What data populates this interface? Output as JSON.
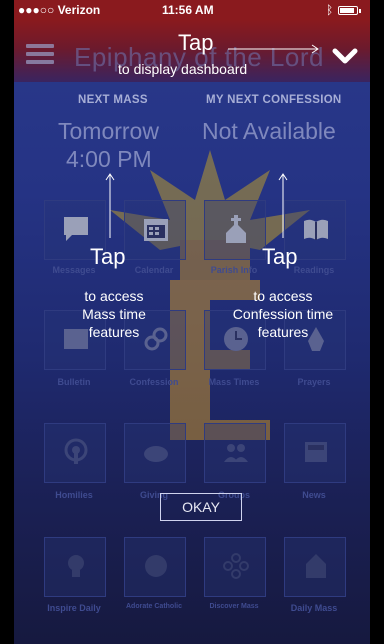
{
  "status_bar": {
    "carrier": "●●●○○ Verizon",
    "time": "11:56 AM"
  },
  "header": {
    "title": "Epiphany of the Lord"
  },
  "next_mass": {
    "label": "NEXT MASS",
    "line1": "Tomorrow",
    "line2": "4:00 PM"
  },
  "next_confession": {
    "label": "MY NEXT CONFESSION",
    "value": "Not Available"
  },
  "grid": {
    "row1": [
      "Messages",
      "Calendar",
      "Parish Info",
      "Readings"
    ],
    "row2": [
      "Bulletin",
      "Confession",
      "Mass Times",
      "Prayers"
    ],
    "row3": [
      "Homilies",
      "Giving",
      "Groups",
      "News"
    ],
    "row4": [
      "Inspire Daily",
      "Adorate Catholic",
      "Discover Mass",
      "Daily Mass"
    ]
  },
  "tutorial": {
    "top_tap": "Tap",
    "top_desc": "to display dashboard",
    "left_tap": "Tap",
    "left_desc": [
      "to access",
      "Mass time",
      "features"
    ],
    "right_tap": "Tap",
    "right_desc": [
      "to access",
      "Confession time",
      "features"
    ],
    "okay": "OKAY"
  }
}
